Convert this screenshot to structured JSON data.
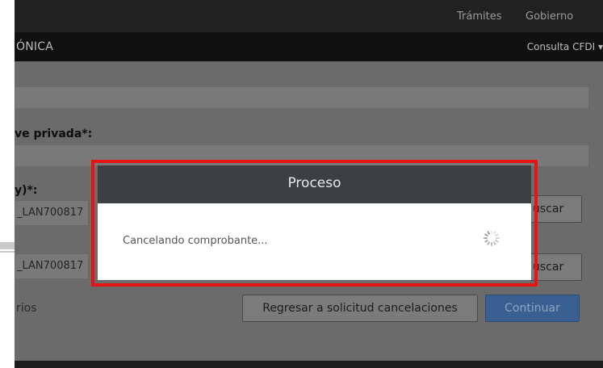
{
  "topbar": {
    "links": [
      "Trámites",
      "Gobierno"
    ]
  },
  "navbar": {
    "brand_fragment": "ÓNICA",
    "menu_item": "Consulta CFDI"
  },
  "form": {
    "label_private_key": "ve privada*:",
    "label_certificate": "y)*:",
    "cert_file_1": "_LAN700817",
    "cert_file_2": "_LAN700817",
    "search_button_1": "uscar",
    "search_button_2": "uscar",
    "required_note": "rios",
    "back_button": "Regresar a solicitud cancelaciones",
    "continue_button": "Continuar"
  },
  "modal": {
    "title": "Proceso",
    "message": "Cancelando comprobante..."
  },
  "colors": {
    "highlight_border": "#e81414",
    "modal_header": "#3c4043",
    "primary_button": "#3a5f91"
  }
}
